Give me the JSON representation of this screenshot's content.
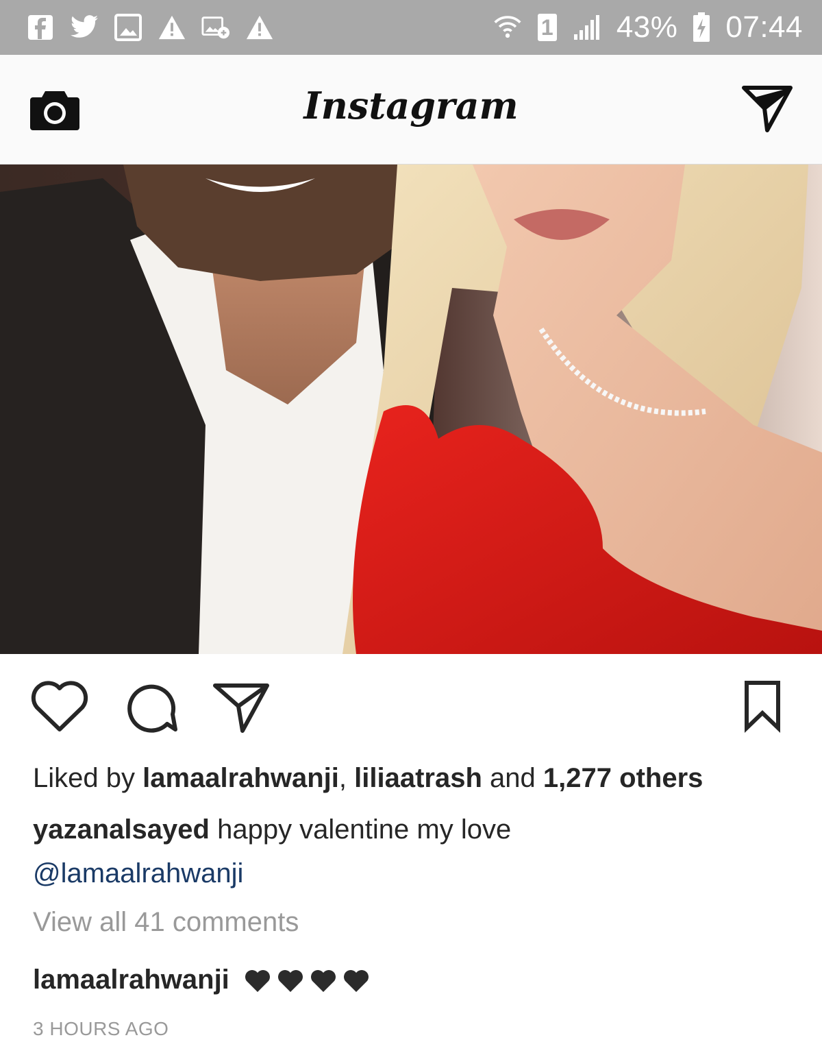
{
  "status_bar": {
    "left_icons": [
      "facebook-icon",
      "twitter-icon",
      "gallery-icon",
      "warning-icon",
      "image-transfer-icon",
      "warning-icon"
    ],
    "sim_slot": "1",
    "battery_percent": "43%",
    "time": "07:44"
  },
  "header": {
    "logo_text": "Instagram",
    "left_icon": "camera-icon",
    "right_icon": "direct-message-icon"
  },
  "post": {
    "photo_icon": "photo",
    "actions": {
      "like_icon": "heart-icon",
      "comment_icon": "comment-icon",
      "share_icon": "share-icon",
      "save_icon": "bookmark-icon"
    },
    "likes": {
      "prefix": "Liked by",
      "user1": "lamaalrahwanji",
      "separator": ",",
      "user2": "liliaatrash",
      "and": "and",
      "others": "1,277 others"
    },
    "caption": {
      "username": "yazanalsayed",
      "text": "happy valentine my love",
      "mention": "@lamaalrahwanji"
    },
    "view_comments": "View all 41 comments",
    "comment": {
      "username": "lamaalrahwanji",
      "hearts": "🖤🖤🖤🖤"
    },
    "timestamp": "3 HOURS AGO"
  }
}
